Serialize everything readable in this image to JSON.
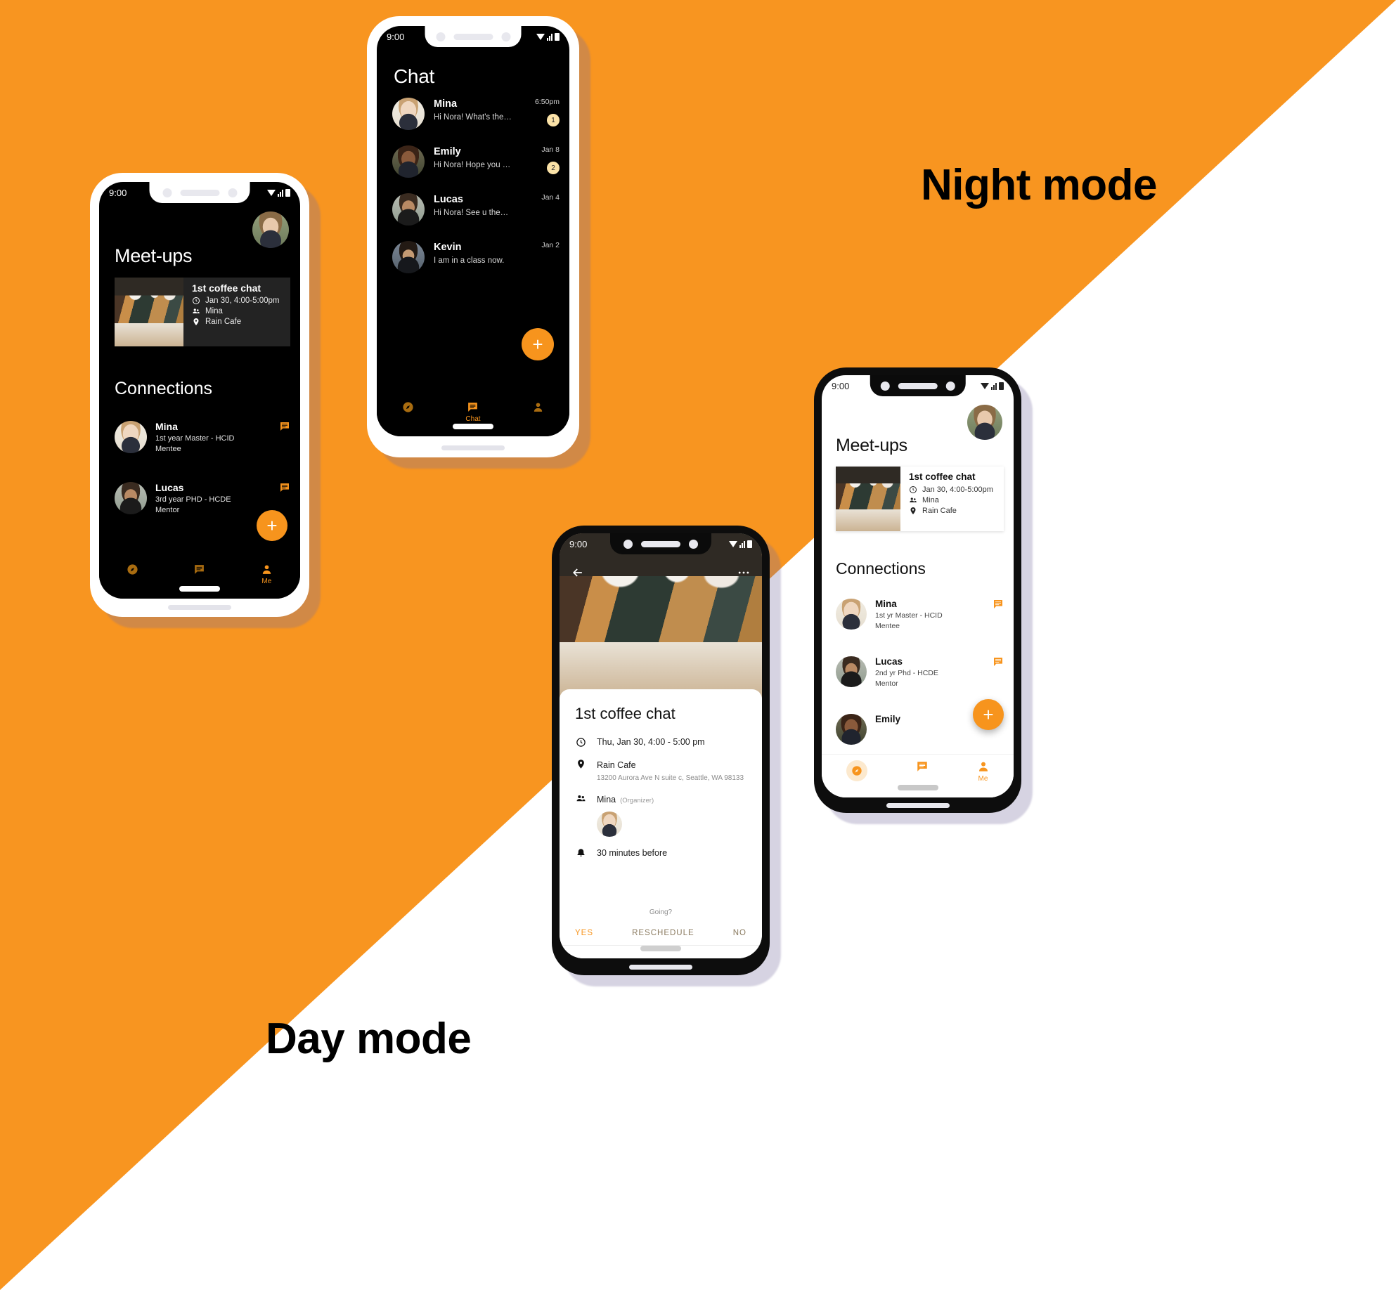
{
  "labels": {
    "night_mode": "Night mode",
    "day_mode": "Day mode"
  },
  "colors": {
    "accent": "#F7941D",
    "background_orange": "#F89520",
    "background_white": "#FFFFFF",
    "dark_screen": "#000000",
    "badge": "#FBE2A7"
  },
  "status_bar": {
    "time": "9:00"
  },
  "phone_night_meetups": {
    "page_title": "Meet-ups",
    "avatar_name": "Nora",
    "meetup_card": {
      "title": "1st coffee chat",
      "time": "Jan 30, 4:00-5:00pm",
      "people": "Mina",
      "place": "Rain Cafe"
    },
    "section_title": "Connections",
    "connections": [
      {
        "name": "Mina",
        "detail": "1st year Master - HCID",
        "role": "Mentee",
        "avatar": "mina"
      },
      {
        "name": "Lucas",
        "detail": "3rd year PHD - HCDE",
        "role": "Mentor",
        "avatar": "lucas"
      }
    ],
    "fab_label": "+",
    "bottom_nav": [
      {
        "icon": "compass-icon",
        "label": ""
      },
      {
        "icon": "chat-icon",
        "label": ""
      },
      {
        "icon": "person-icon",
        "label": "Me"
      }
    ]
  },
  "phone_night_chat": {
    "page_title": "Chat",
    "conversations": [
      {
        "name": "Mina",
        "preview": "Hi Nora! What's the time ...",
        "time": "6:50pm",
        "unread": "1",
        "avatar": "mina"
      },
      {
        "name": "Emily",
        "preview": "Hi Nora! Hope you are doi...",
        "time": "Jan 8",
        "unread": "2",
        "avatar": "emily"
      },
      {
        "name": "Lucas",
        "preview": "Hi Nora! See u then! :)",
        "time": "Jan 4",
        "unread": "",
        "avatar": "lucas"
      },
      {
        "name": "Kevin",
        "preview": "I am in a class now.",
        "time": "Jan 2",
        "unread": "",
        "avatar": "kevin"
      }
    ],
    "fab_label": "+",
    "bottom_nav": [
      {
        "icon": "compass-icon",
        "label": ""
      },
      {
        "icon": "chat-icon",
        "label": "Chat"
      },
      {
        "icon": "person-icon",
        "label": ""
      }
    ]
  },
  "phone_day_event": {
    "back_icon": "arrow-left-icon",
    "more_icon": "more-horizontal-icon",
    "title": "1st coffee chat",
    "time": "Thu, Jan 30, 4:00 - 5:00 pm",
    "place_name": "Rain Cafe",
    "place_address": "13200 Aurora Ave N suite c, Seattle, WA 98133",
    "organizer_name": "Mina",
    "organizer_tag": "(Organizer)",
    "reminder": "30 minutes before",
    "going_prompt": "Going?",
    "actions": {
      "yes": "YES",
      "reschedule": "RESCHEDULE",
      "no": "NO"
    }
  },
  "phone_day_meetups": {
    "page_title": "Meet-ups",
    "avatar_name": "Nora",
    "meetup_card": {
      "title": "1st coffee chat",
      "time": "Jan 30, 4:00-5:00pm",
      "people": "Mina",
      "place": "Rain Cafe"
    },
    "section_title": "Connections",
    "connections": [
      {
        "name": "Mina",
        "detail": "1st yr Master - HCID",
        "role": "Mentee",
        "avatar": "mina"
      },
      {
        "name": "Lucas",
        "detail": "2nd yr Phd - HCDE",
        "role": "Mentor",
        "avatar": "lucas"
      },
      {
        "name": "Emily",
        "detail": "",
        "role": "",
        "avatar": "emily"
      }
    ],
    "fab_label": "+",
    "bottom_nav": [
      {
        "icon": "compass-icon",
        "label": ""
      },
      {
        "icon": "chat-icon",
        "label": ""
      },
      {
        "icon": "person-icon",
        "label": "Me"
      }
    ]
  }
}
